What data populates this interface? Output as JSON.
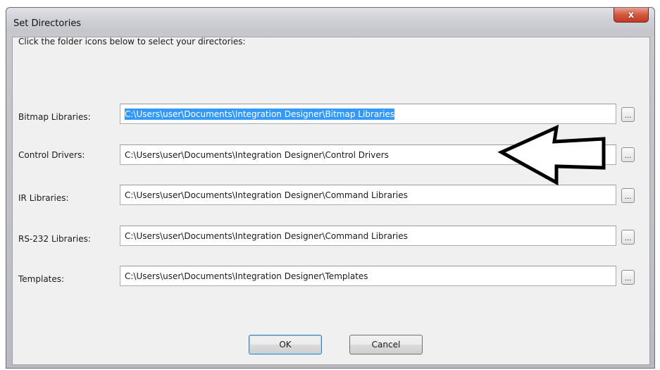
{
  "window": {
    "title": "Set Directories",
    "close_label": "x"
  },
  "instructions": "Click the folder icons below to select your directories:",
  "rows": [
    {
      "label": "Bitmap Libraries:",
      "value": "C:\\Users\\user\\Documents\\Integration Designer\\Bitmap Libraries",
      "selected": true
    },
    {
      "label": "Control Drivers:",
      "value": "C:\\Users\\user\\Documents\\Integration Designer\\Control Drivers",
      "selected": false
    },
    {
      "label": "IR Libraries:",
      "value": "C:\\Users\\user\\Documents\\Integration Designer\\Command Libraries",
      "selected": false
    },
    {
      "label": "RS-232 Libraries:",
      "value": "C:\\Users\\user\\Documents\\Integration Designer\\Command Libraries",
      "selected": false
    },
    {
      "label": "Templates:",
      "value": "C:\\Users\\user\\Documents\\Integration Designer\\Templates",
      "selected": false
    }
  ],
  "browse_label": "...",
  "buttons": {
    "ok": "OK",
    "cancel": "Cancel"
  },
  "colors": {
    "selection": "#3399ff",
    "close": "#c03b23",
    "default_button_border": "#3c7fb1"
  },
  "annotation": {
    "shape": "arrow",
    "points_to": "Control Drivers"
  }
}
